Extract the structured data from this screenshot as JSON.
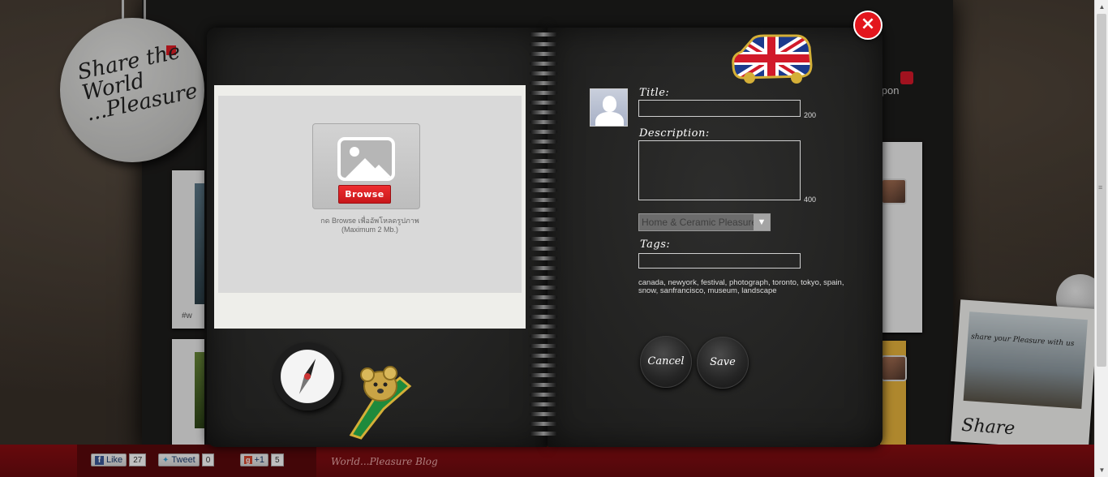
{
  "background": {
    "logo_text": "Share the World ...Pleasure",
    "username": "sopon",
    "card_caption": "#w",
    "polaroid_title": "Share",
    "polaroid_note": "share your Pleasure with us"
  },
  "share_bar": {
    "facebook": {
      "label": "Like",
      "count": "27"
    },
    "twitter": {
      "label": "Tweet",
      "count": "0"
    },
    "google": {
      "label": "+1",
      "count": "5"
    },
    "blog_link": "World...Pleasure Blog"
  },
  "modal": {
    "close_label": "×",
    "upload": {
      "browse_label": "Browse",
      "hint_line1": "กด Browse เพื่ออัพโหลดรูปภาพ",
      "hint_line2": "(Maximum 2 Mb.)"
    },
    "form": {
      "title_label": "Title:",
      "title_value": "",
      "title_max": "200",
      "description_label": "Description:",
      "description_value": "",
      "description_max": "400",
      "category_selected": "Home & Ceramic Pleasure",
      "tags_label": "Tags:",
      "tags_value": "",
      "tags_examples": "canada, newyork, festival, photograph, toronto, tokyo, spain, snow, sanfrancisco, museum, landscape"
    },
    "buttons": {
      "cancel": "Cancel",
      "save": "Save"
    }
  },
  "icons": {
    "upload": "image-placeholder-icon",
    "close": "close-icon",
    "avatar": "user-silhouette-icon",
    "select_arrow": "chevron-down-icon"
  },
  "colors": {
    "accent_red": "#e3161d",
    "page_dark": "#1c1c1b",
    "share_bar": "#7a0c10"
  }
}
